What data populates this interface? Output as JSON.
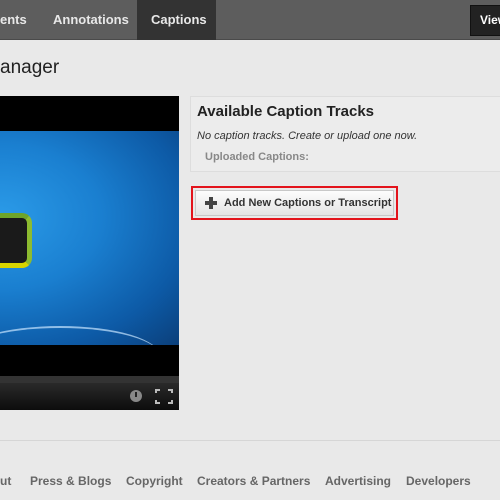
{
  "nav": {
    "tabs": [
      {
        "label": "ents",
        "active": false
      },
      {
        "label": "Annotations",
        "active": false
      },
      {
        "label": "Captions",
        "active": true
      }
    ],
    "view_button": "View"
  },
  "page_title": "anager",
  "panel": {
    "heading": "Available Caption Tracks",
    "empty_message": "No caption tracks. Create or upload one now.",
    "uploaded_label": "Uploaded Captions:"
  },
  "add_button": {
    "label": "Add New Captions or Transcript",
    "icon": "plus-icon",
    "highlight_color": "#e3141c"
  },
  "player": {
    "icons": [
      "clock-icon",
      "fullscreen-icon"
    ]
  },
  "footer": {
    "links": [
      "ut",
      "Press & Blogs",
      "Copyright",
      "Creators & Partners",
      "Advertising",
      "Developers"
    ]
  }
}
